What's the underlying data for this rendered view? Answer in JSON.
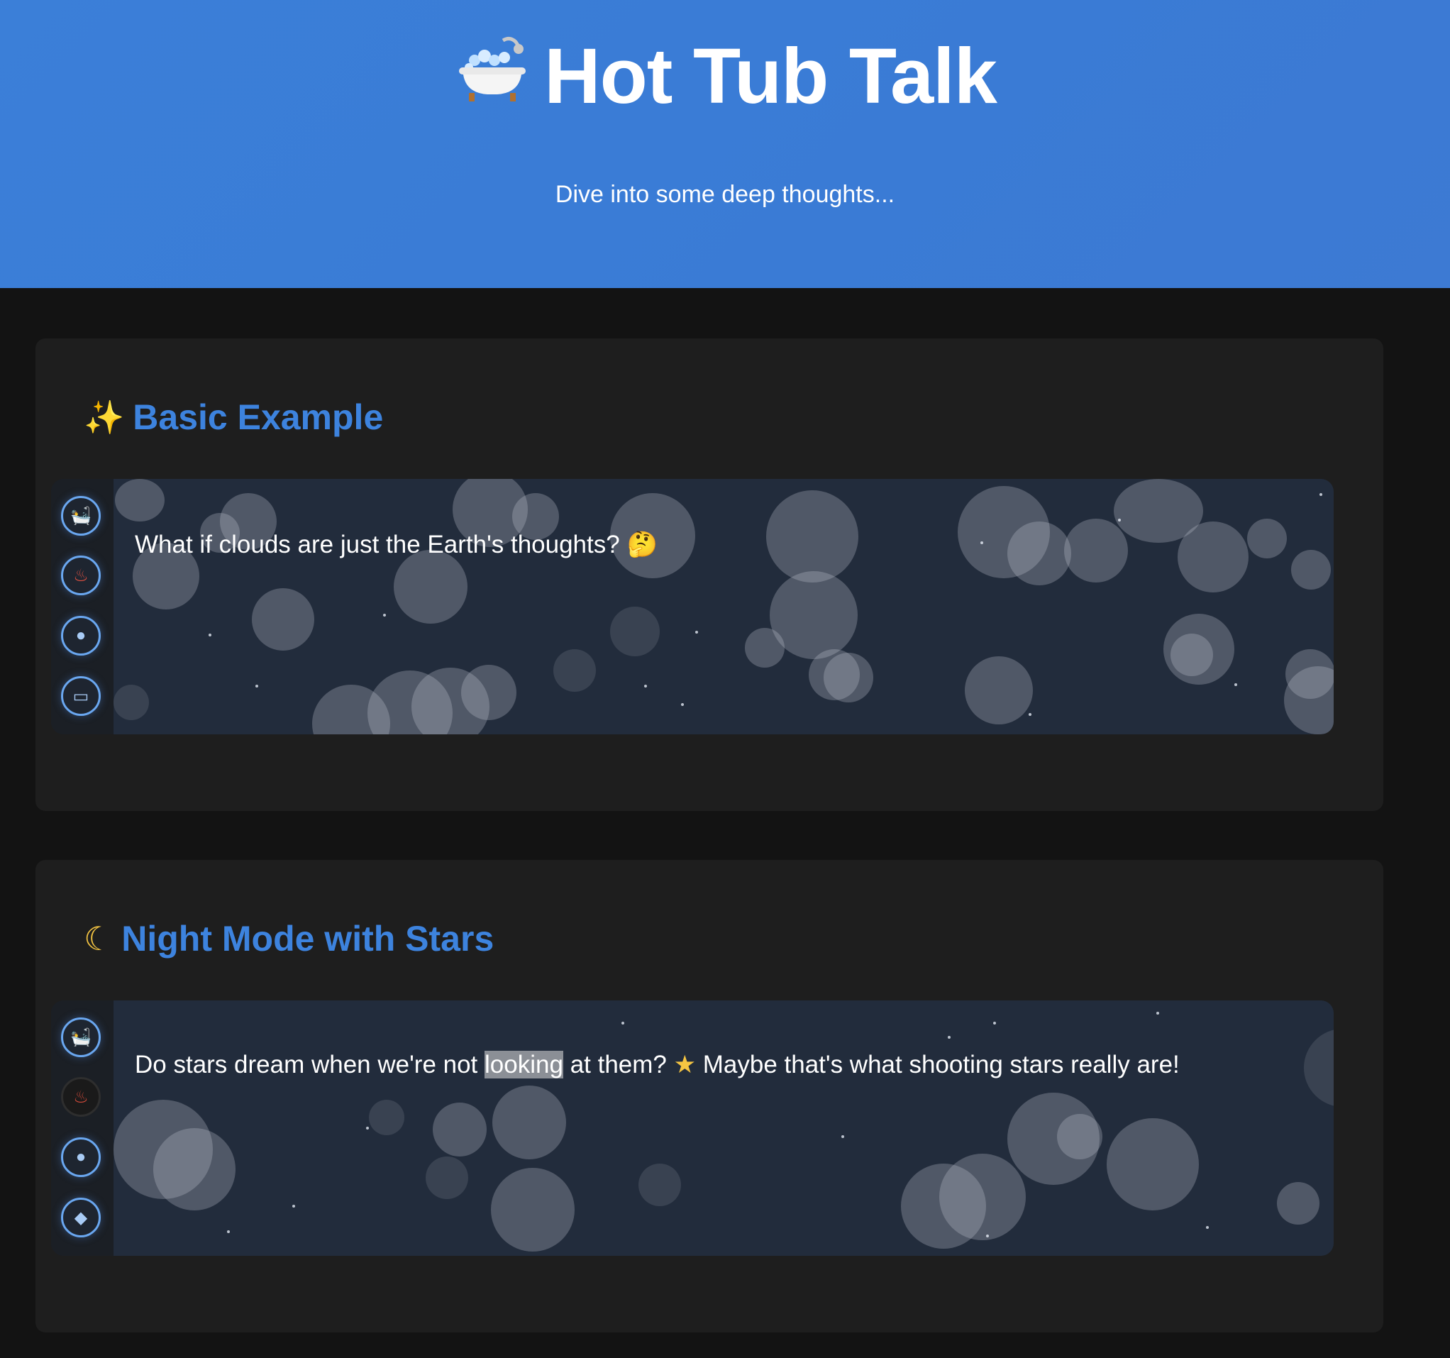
{
  "header": {
    "icon": "bathtub-icon",
    "title": "Hot Tub Talk",
    "subtitle": "Dive into some deep thoughts..."
  },
  "sections": [
    {
      "icon": "sparkles-icon",
      "title": "Basic Example",
      "thought": {
        "text": "What if clouds are just the Earth's thoughts?",
        "emoji": "thinking-face-icon"
      },
      "tools": [
        {
          "name": "bubbles-tool",
          "icon": "bubbles-icon",
          "active": true
        },
        {
          "name": "heat-tool",
          "icon": "hot-springs-icon",
          "active": true
        },
        {
          "name": "splash-tool",
          "icon": "droplet-icon",
          "active": true
        },
        {
          "name": "toggle-tool",
          "icon": "toggle-icon",
          "active": true
        }
      ]
    },
    {
      "icon": "crescent-moon-icon",
      "title": "Night Mode with Stars",
      "thought": {
        "before": "Do stars dream when we're not",
        "highlight": "looking",
        "middle": "at them?",
        "after": "Maybe that's what shooting stars really are!",
        "emoji": "star-icon"
      },
      "tools": [
        {
          "name": "bubbles-tool",
          "icon": "bubbles-icon",
          "active": true
        },
        {
          "name": "heat-tool",
          "icon": "hot-springs-icon",
          "active": false
        },
        {
          "name": "splash-tool",
          "icon": "droplet-icon",
          "active": true
        },
        {
          "name": "eraser-tool",
          "icon": "eraser-icon",
          "active": true
        }
      ]
    }
  ],
  "colors": {
    "header_bg": "#3b7fd8",
    "section_title": "#3d83de",
    "page_bg": "#131313",
    "card_bg": "#1e1e1e",
    "tub_bg": "#222c3c"
  }
}
